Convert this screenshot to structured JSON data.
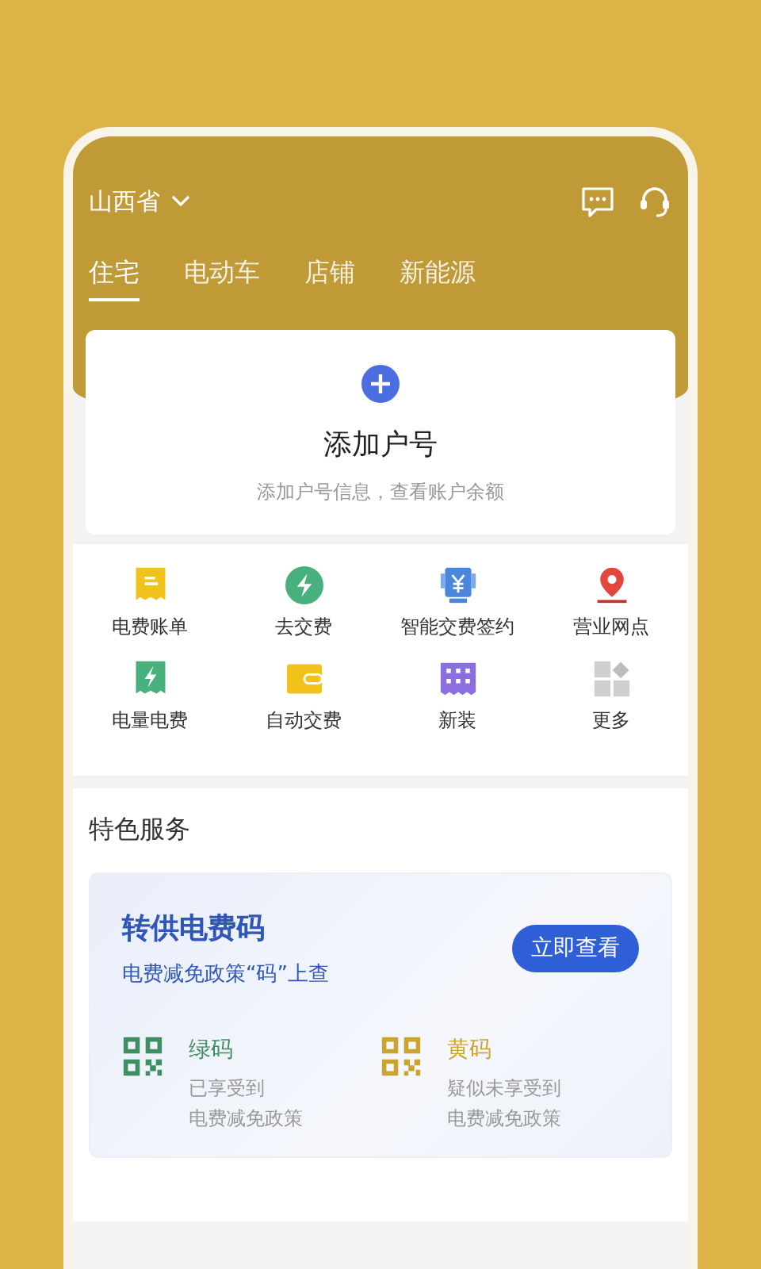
{
  "header": {
    "region": "山西省",
    "tabs": [
      {
        "label": "住宅",
        "selected": true
      },
      {
        "label": "电动车",
        "selected": false
      },
      {
        "label": "店铺",
        "selected": false
      },
      {
        "label": "新能源",
        "selected": false
      }
    ]
  },
  "account_card": {
    "title": "添加户号",
    "subtitle": "添加户号信息，查看账户余额"
  },
  "services": [
    {
      "label": "电费账单",
      "kind": "bill"
    },
    {
      "label": "去交费",
      "kind": "pay"
    },
    {
      "label": "智能交费签约",
      "kind": "sign"
    },
    {
      "label": "营业网点",
      "kind": "location"
    },
    {
      "label": "电量电费",
      "kind": "usage"
    },
    {
      "label": "自动交费",
      "kind": "wallet"
    },
    {
      "label": "新装",
      "kind": "install"
    },
    {
      "label": "更多",
      "kind": "more"
    }
  ],
  "featured": {
    "title": "特色服务",
    "banner": {
      "title": "转供电费码",
      "subtitle": "电费减免政策“码”上查",
      "button": "立即查看",
      "codes": [
        {
          "name": "绿码",
          "color": "#3f8f63",
          "lines": [
            "已享受到",
            "电费减免政策"
          ]
        },
        {
          "name": "黄码",
          "color": "#c9a530",
          "lines": [
            "疑似未享受到",
            "电费减免政策"
          ]
        }
      ]
    }
  }
}
